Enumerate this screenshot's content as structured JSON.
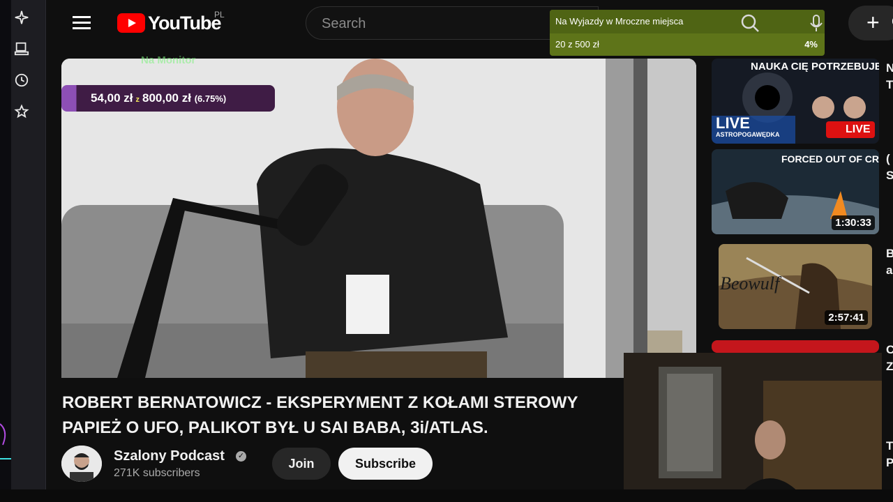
{
  "header": {
    "logo_text": "YouTube",
    "country_code": "PL",
    "search_placeholder": "Search",
    "create_label": "C"
  },
  "overlay": {
    "goal_title": "Na Wyjazdy w Mroczne miejsca",
    "goal_amount": "20 z 500 zł",
    "goal_percent": "4%",
    "monitor_label": "Na Monitor",
    "donation_current": "54,00 zł",
    "donation_sep": "z",
    "donation_target": "800,00 zł",
    "donation_percent": "(6.75%)",
    "accent_color": "#5e7419"
  },
  "video": {
    "title_line1": "ROBERT BERNATOWICZ - EKSPERYMENT Z KOŁAMI STEROWY",
    "title_line2": "PAPIEŻ O UFO, PALIKOT BYŁ U SAI BABA, 3i/ATLAS.",
    "channel_name": "Szalony Podcast",
    "subscribers": "271K subscribers",
    "join_label": "Join",
    "subscribe_label": "Subscribe"
  },
  "recommendations": [
    {
      "thumb_headline": "NAUKA CIĘ POTRZEBUJE!",
      "badge": "LIVE",
      "live_badge": "LIVE",
      "caption": "ASTROPOGAWĘDKA",
      "meta": "N",
      "meta2": "T"
    },
    {
      "thumb_headline": "FORCED OUT OF CRYPTIDZONE",
      "duration": "1:30:33",
      "meta": "(",
      "meta2": "S"
    },
    {
      "thumb_headline": "Beowulf",
      "duration": "2:57:41",
      "meta": "B",
      "meta2": "a"
    },
    {
      "meta": "C",
      "meta2": "Z"
    },
    {
      "meta": "T",
      "meta2": "P"
    }
  ]
}
